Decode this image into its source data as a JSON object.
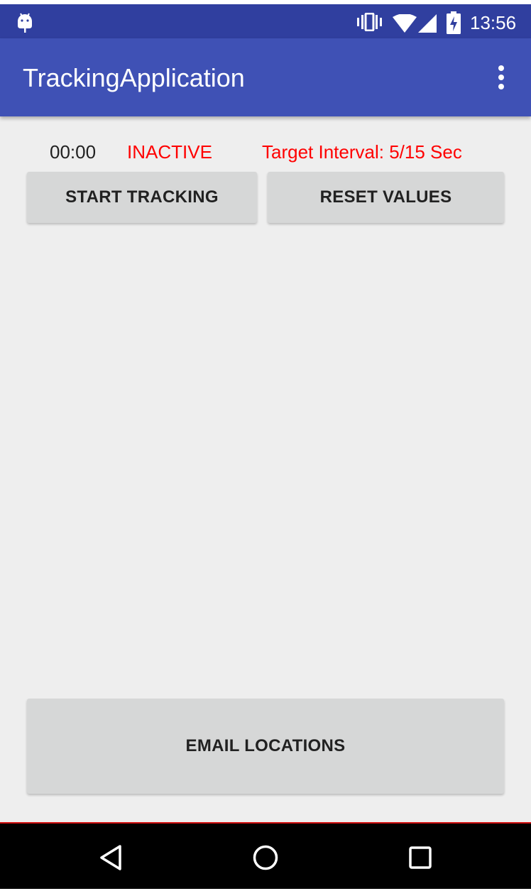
{
  "status_bar": {
    "time": "13:56",
    "icons": [
      "android-debug-icon",
      "vibrate-icon",
      "wifi-icon",
      "cell-signal-icon",
      "battery-charging-icon"
    ]
  },
  "app_bar": {
    "title": "TrackingApplication",
    "menu_icon": "overflow-menu-icon"
  },
  "tracking": {
    "timer": "00:00",
    "state": "INACTIVE",
    "target_interval": "Target Interval: 5/15 Sec"
  },
  "buttons": {
    "start": "START TRACKING",
    "reset": "RESET VALUES",
    "email": "EMAIL LOCATIONS"
  },
  "nav_bar": {
    "icons": [
      "back-icon",
      "home-icon",
      "recents-icon"
    ]
  },
  "colors": {
    "status_bar": "#303f9f",
    "app_bar": "#3f51b5",
    "alert_text": "#ff0000",
    "background": "#eeeeee",
    "button": "#d6d7d7"
  }
}
